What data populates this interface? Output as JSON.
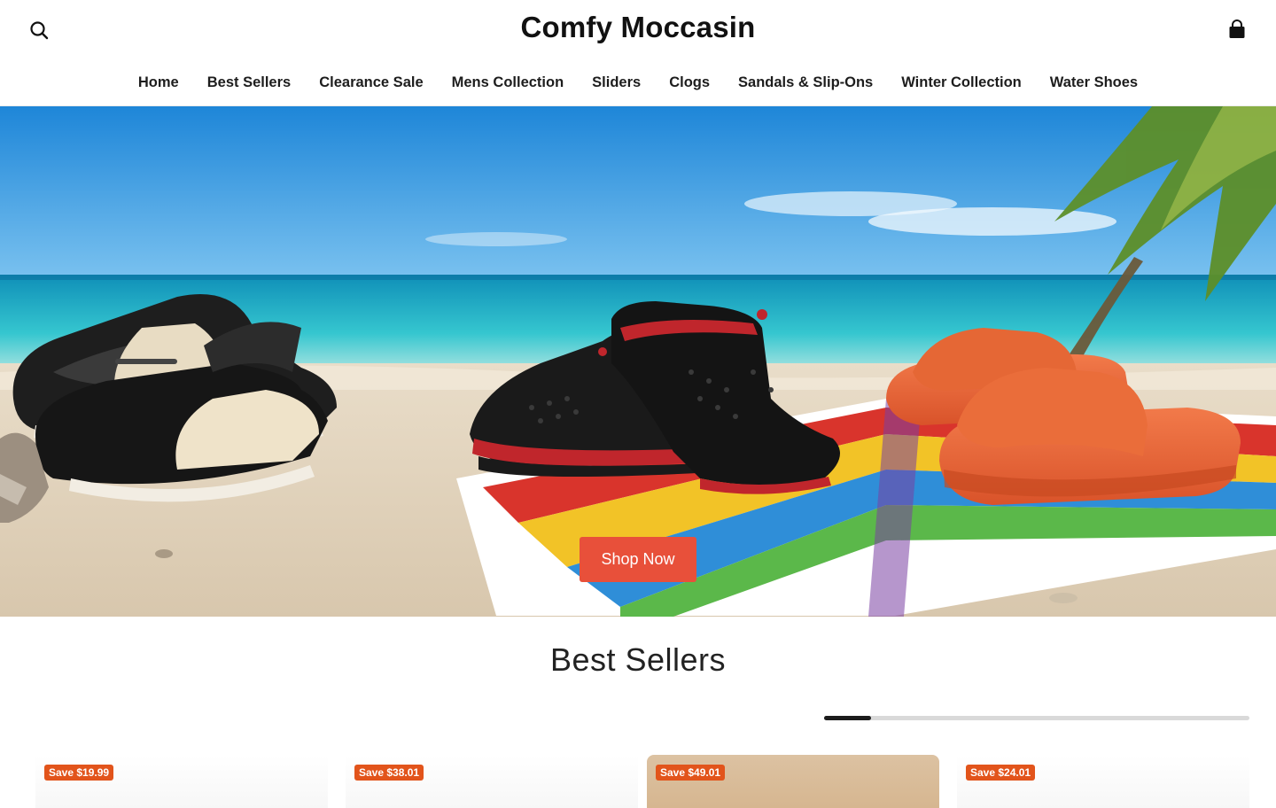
{
  "header": {
    "logo": "Comfy Moccasin",
    "search_icon": "search-icon",
    "cart_icon": "shopping-bag-icon"
  },
  "nav": {
    "items": [
      {
        "label": "Home"
      },
      {
        "label": "Best Sellers"
      },
      {
        "label": "Clearance Sale"
      },
      {
        "label": "Mens Collection"
      },
      {
        "label": "Sliders"
      },
      {
        "label": "Clogs"
      },
      {
        "label": "Sandals & Slip-Ons"
      },
      {
        "label": "Winter Collection"
      },
      {
        "label": "Water Shoes"
      }
    ]
  },
  "hero": {
    "cta_label": "Shop Now",
    "cta_color": "#e8503a"
  },
  "best_sellers": {
    "title": "Best Sellers",
    "carousel_progress": 0.11,
    "cards": [
      {
        "badge": "Save $19.99"
      },
      {
        "badge": "Save $38.01"
      },
      {
        "badge": "Save $49.01"
      },
      {
        "badge": "Save $24.01"
      }
    ]
  },
  "colors": {
    "accent": "#e8503a",
    "badge": "#e2541b"
  }
}
